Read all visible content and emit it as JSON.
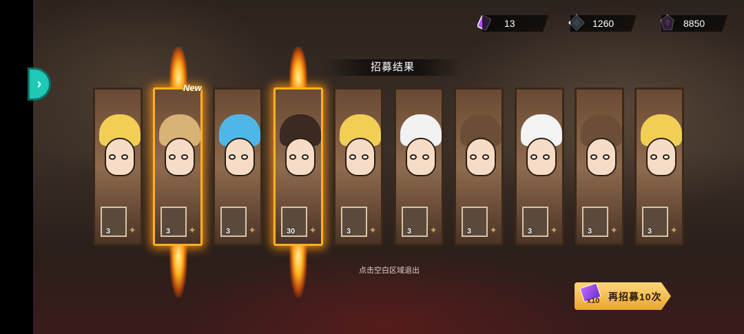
{
  "currencies": [
    {
      "name": "ticket",
      "value": "13",
      "icon": "purple-ticket-icon",
      "color": "#b44df0"
    },
    {
      "name": "diamond",
      "value": "1260",
      "icon": "blue-diamond-icon",
      "color": "#7ec7ff"
    },
    {
      "name": "crystal",
      "value": "8850",
      "icon": "purple-crystal-icon",
      "color": "#c15df2"
    }
  ],
  "title": "招募结果",
  "cards": [
    {
      "count": "3",
      "new": false,
      "highlight": false,
      "hair": "#f1cf55"
    },
    {
      "count": "3",
      "new": true,
      "highlight": true,
      "hair": "#d8b276"
    },
    {
      "count": "3",
      "new": false,
      "highlight": false,
      "hair": "#4fb7e8"
    },
    {
      "count": "30",
      "new": false,
      "highlight": true,
      "hair": "#3a2a22"
    },
    {
      "count": "3",
      "new": false,
      "highlight": false,
      "hair": "#f1cf55"
    },
    {
      "count": "3",
      "new": false,
      "highlight": false,
      "hair": "#f2f2f2"
    },
    {
      "count": "3",
      "new": false,
      "highlight": false,
      "hair": "#6b4e35"
    },
    {
      "count": "3",
      "new": false,
      "highlight": false,
      "hair": "#f3f3f3"
    },
    {
      "count": "3",
      "new": false,
      "highlight": false,
      "hair": "#6b4e35"
    },
    {
      "count": "3",
      "new": false,
      "highlight": false,
      "hair": "#f1cf55"
    }
  ],
  "new_label": "New",
  "exit_hint": "点击空白区域退出",
  "recruit_again": {
    "multiplier": "x10",
    "label": "再招募10次"
  }
}
